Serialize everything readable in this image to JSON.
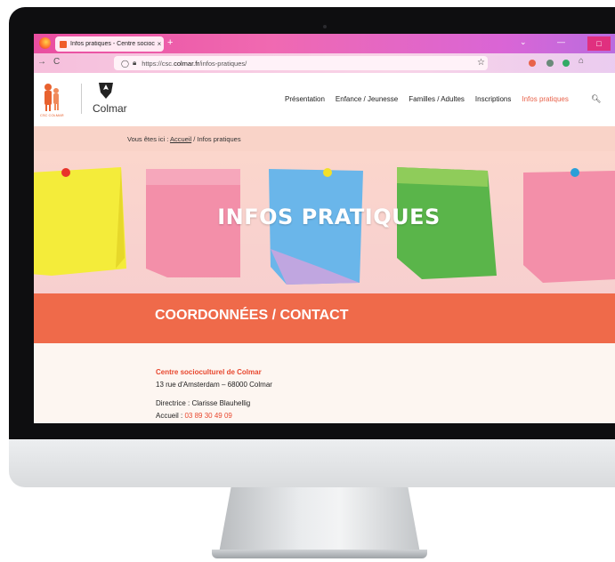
{
  "browser": {
    "tab_title": "Infos pratiques - Centre sociocu",
    "new_tab": "+",
    "close_tab": "×",
    "url_prefix": "https://csc.",
    "url_domain": "colmar.fr",
    "url_path": "/infos-pratiques/"
  },
  "site": {
    "logo_text": "Colmar",
    "logo_subtext": "CSC COLMAR",
    "menu": [
      "Présentation",
      "Enfance / Jeunesse",
      "Familles / Adultes",
      "Inscriptions",
      "Infos pratiques"
    ],
    "active_menu": "Infos pratiques",
    "breadcrumb_prefix": "Vous êtes ici :",
    "breadcrumb_home": "Accueil",
    "breadcrumb_current": "/ Infos pratiques"
  },
  "hero": {
    "title": "INFOS PRATIQUES"
  },
  "contact": {
    "band_title": "COORDONNÉES / CONTACT",
    "org_name": "Centre socioculturel de Colmar",
    "address": "13 rue d'Amsterdam – 68000 Colmar",
    "director": "Directrice : Clarisse Blauhellig",
    "reception_label": "Accueil :",
    "reception_phone": "03 89 30 49 09"
  },
  "colors": {
    "accent": "#ef6a4a",
    "link": "#e8482f",
    "tabbar": "#e94ea0"
  },
  "icons": [
    "firefox-icon",
    "reload-icon",
    "shield-icon",
    "lock-icon",
    "star-icon",
    "search-icon"
  ]
}
